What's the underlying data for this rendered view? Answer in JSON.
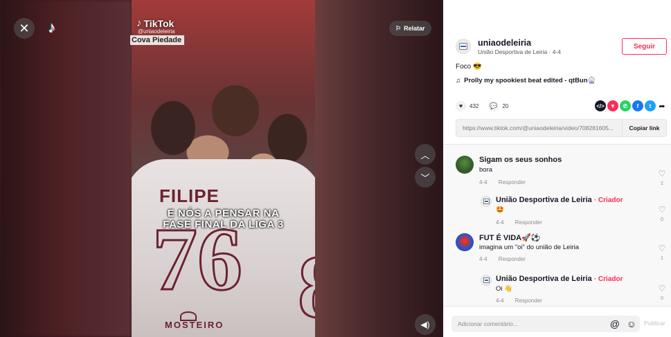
{
  "video": {
    "watermark_brand": "TikTok",
    "watermark_handle": "@uniaodeleiria",
    "location_label": "Cova Piedade",
    "overlay_line1": "E NÓS A PENSAR NA",
    "overlay_line2": "FASE FINAL DA LIGA 3",
    "shirt_name": "FILIPE",
    "shirt_number": "76",
    "shirt_number_partial": "8",
    "sponsor_text": "MOSTEIRO",
    "report_label": "Relatar",
    "icons": {
      "close": "close-icon",
      "tiktok": "tiktok-logo-icon",
      "report": "flag-icon",
      "up": "chevron-up-icon",
      "down": "chevron-down-icon",
      "volume": "volume-icon"
    }
  },
  "author": {
    "username": "uniaodeleiria",
    "subtitle": "União Desportiva de Leiria · 4-4",
    "follow_label": "Seguir"
  },
  "post": {
    "description": "Foco 😎",
    "music": "Prolly my spookiest beat edited - qtBun🎡"
  },
  "stats": {
    "likes": "432",
    "comments": "20"
  },
  "share": {
    "icons": [
      "embed-icon",
      "paper-plane-icon",
      "whatsapp-icon",
      "facebook-icon",
      "twitter-icon",
      "share-arrow-icon"
    ],
    "colors": {
      "embed": "#161823",
      "send": "#fe2c55",
      "whatsapp": "#25d366",
      "facebook": "#1877f2",
      "twitter": "#1da1f2"
    }
  },
  "link": {
    "url": "https://www.tiktok.com/@uniaodeleiria/video/708281605...",
    "copy_label": "Copiar link"
  },
  "comments": [
    {
      "name": "Sigam os seus sonhos",
      "text": "bora",
      "date": "4-4",
      "reply_label": "Responder",
      "likes": "2"
    },
    {
      "name": "União Desportiva de Leiria",
      "creator_label": "· Criador",
      "text": "🤩",
      "date": "4-4",
      "reply_label": "Responder",
      "likes": "0"
    },
    {
      "name": "FUT É VIDA🚀⚽",
      "text": "imagina um \"oi\" do união de Leiria",
      "date": "4-4",
      "reply_label": "Responder",
      "likes": "1"
    },
    {
      "name": "União Desportiva de Leiria",
      "creator_label": "· Criador",
      "text": "Oi 👋",
      "date": "4-4",
      "reply_label": "Responder",
      "likes": "0"
    }
  ],
  "comment_input": {
    "placeholder": "Adicionar comentário...",
    "publish_label": "Publicar"
  },
  "accent_color": "#fe2c55"
}
